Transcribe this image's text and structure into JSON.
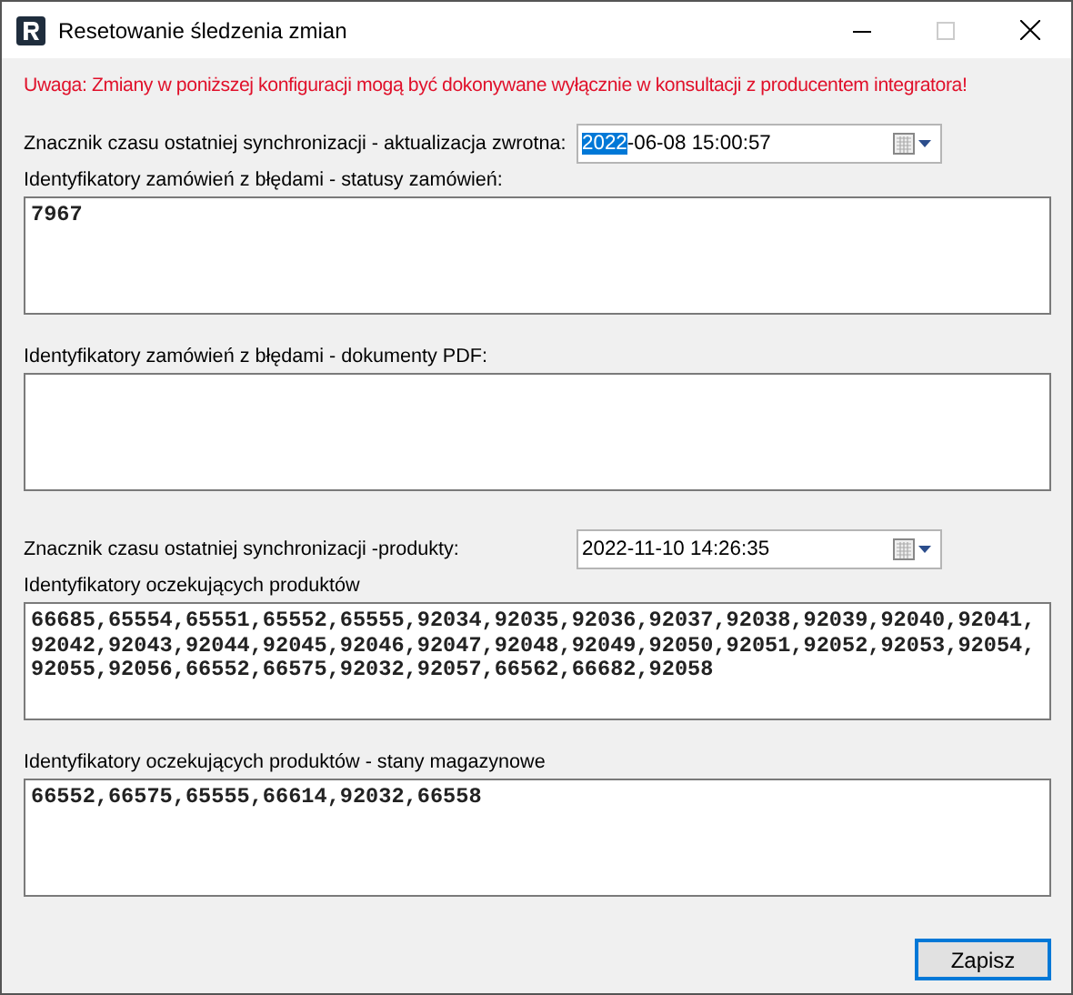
{
  "window": {
    "title": "Resetowanie śledzenia zmian"
  },
  "warning": "Uwaga: Zmiany w poniższej konfiguracji mogą być dokonywane wyłącznie w konsultacji z producentem integratora!",
  "fields": [
    {
      "kind": "date",
      "label": "Znacznik czasu ostatniej synchronizacji - aktualizacja zwrotna:",
      "value_selected": "2022",
      "value": "-06-08 15:00:57"
    },
    {
      "kind": "text",
      "label": "Identyfikatory zamówień z błędami - statusy zamówień:",
      "value": "7967"
    },
    {
      "kind": "text",
      "label": "Identyfikatory zamówień z błędami - dokumenty PDF:"
    },
    {
      "kind": "date",
      "label": "Znacznik czasu ostatniej synchronizacji -produkty:",
      "value": "2022-11-10 14:26:35"
    },
    {
      "kind": "text",
      "label": "Identyfikatory oczekujących produktów",
      "value": "66685,65554,65551,65552,65555,92034,92035,92036,92037,92038,92039,92040,92041,92042,92043,92044,92045,92046,92047,92048,92049,92050,92051,92052,92053,92054,92055,92056,66552,66575,92032,92057,66562,66682,92058"
    },
    {
      "kind": "text",
      "label": "Identyfikatory oczekujących produktów - stany magazynowe",
      "value": "66552,66575,65555,66614,92032,66558"
    }
  ],
  "buttons": [
    "Zapisz"
  ]
}
